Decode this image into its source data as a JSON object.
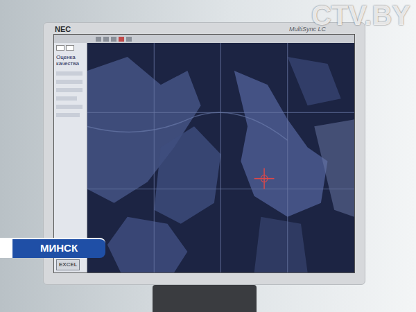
{
  "channel_logo": "CTV.BY",
  "caption": "МИНСК",
  "monitor": {
    "brand": "NEC",
    "model": "MultiSync LC"
  },
  "app": {
    "side_panel": {
      "heading": "Оценка качества",
      "button": "EXCEL"
    }
  }
}
